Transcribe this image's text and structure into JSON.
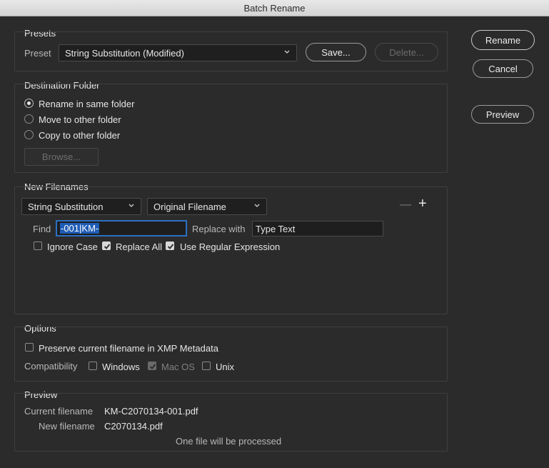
{
  "window": {
    "title": "Batch Rename"
  },
  "presets": {
    "section_title": "Presets",
    "preset_label": "Preset",
    "preset_value": "String Substitution (Modified)",
    "save_label": "Save...",
    "delete_label": "Delete..."
  },
  "side_buttons": {
    "rename": "Rename",
    "cancel": "Cancel",
    "preview": "Preview"
  },
  "destination": {
    "section_title": "Destination Folder",
    "options": [
      {
        "label": "Rename in same folder",
        "selected": true
      },
      {
        "label": "Move to other folder",
        "selected": false
      },
      {
        "label": "Copy to other folder",
        "selected": false
      }
    ],
    "browse_label": "Browse..."
  },
  "new_filenames": {
    "section_title": "New Filenames",
    "type_select": "String Substitution",
    "target_select": "Original Filename",
    "find_label": "Find",
    "find_value": "-001|KM-",
    "replace_label": "Replace with",
    "replace_value": "Type Text",
    "ignore_case": {
      "label": "Ignore Case",
      "checked": false
    },
    "replace_all": {
      "label": "Replace All",
      "checked": true
    },
    "use_regex": {
      "label": "Use Regular Expression",
      "checked": true
    },
    "remove_symbol": "—",
    "add_symbol": "+"
  },
  "options": {
    "section_title": "Options",
    "preserve": {
      "label": "Preserve current filename in XMP Metadata",
      "checked": false
    },
    "compat_label": "Compatibility",
    "windows": {
      "label": "Windows",
      "checked": false
    },
    "macos": {
      "label": "Mac OS",
      "checked": true,
      "disabled": true
    },
    "unix": {
      "label": "Unix",
      "checked": false
    }
  },
  "preview": {
    "section_title": "Preview",
    "current_label": "Current filename",
    "current_value": "KM-C2070134-001.pdf",
    "new_label": "New filename",
    "new_value": "C2070134.pdf",
    "status": "One file will be processed"
  },
  "colors": {
    "background": "#2b2b2b",
    "selection": "#1f5db5",
    "focus_ring": "#2c6fc2"
  }
}
